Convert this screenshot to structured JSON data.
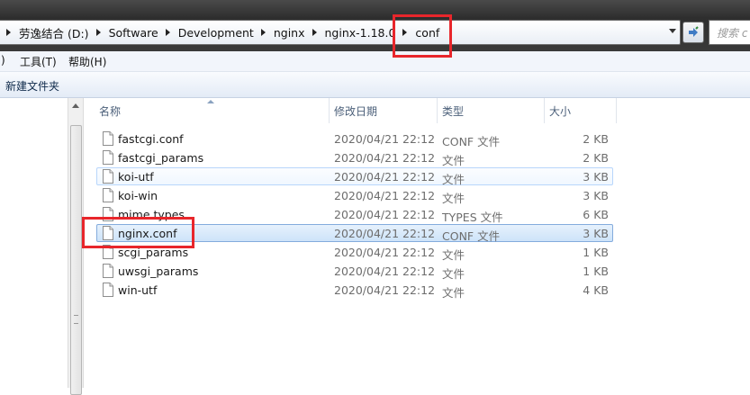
{
  "address_bar": {
    "crumbs": [
      "劳逸结合 (D:)",
      "Software",
      "Development",
      "nginx",
      "nginx-1.18.0",
      "conf"
    ]
  },
  "search": {
    "placeholder": "搜索 c"
  },
  "menu": {
    "items": [
      ")",
      "工具(T)",
      "帮助(H)"
    ]
  },
  "command_bar": {
    "new_folder": "新建文件夹"
  },
  "columns": {
    "name": "名称",
    "date": "修改日期",
    "type": "类型",
    "size": "大小"
  },
  "files": [
    {
      "name": "fastcgi.conf",
      "date": "2020/04/21 22:12",
      "type": "CONF 文件",
      "size": "2 KB",
      "state": "normal"
    },
    {
      "name": "fastcgi_params",
      "date": "2020/04/21 22:12",
      "type": "文件",
      "size": "2 KB",
      "state": "normal"
    },
    {
      "name": "koi-utf",
      "date": "2020/04/21 22:12",
      "type": "文件",
      "size": "3 KB",
      "state": "hover"
    },
    {
      "name": "koi-win",
      "date": "2020/04/21 22:12",
      "type": "文件",
      "size": "3 KB",
      "state": "normal"
    },
    {
      "name": "mime.types",
      "date": "2020/04/21 22:12",
      "type": "TYPES 文件",
      "size": "6 KB",
      "state": "normal"
    },
    {
      "name": "nginx.conf",
      "date": "2020/04/21 22:12",
      "type": "CONF 文件",
      "size": "3 KB",
      "state": "selected"
    },
    {
      "name": "scgi_params",
      "date": "2020/04/21 22:12",
      "type": "文件",
      "size": "1 KB",
      "state": "normal"
    },
    {
      "name": "uwsgi_params",
      "date": "2020/04/21 22:12",
      "type": "文件",
      "size": "1 KB",
      "state": "normal"
    },
    {
      "name": "win-utf",
      "date": "2020/04/21 22:12",
      "type": "文件",
      "size": "4 KB",
      "state": "normal"
    }
  ],
  "icons": {
    "file": "file-icon",
    "refresh": "refresh-icon"
  },
  "colors": {
    "annotation": "#e8262b",
    "selection": "#cde3f9"
  }
}
